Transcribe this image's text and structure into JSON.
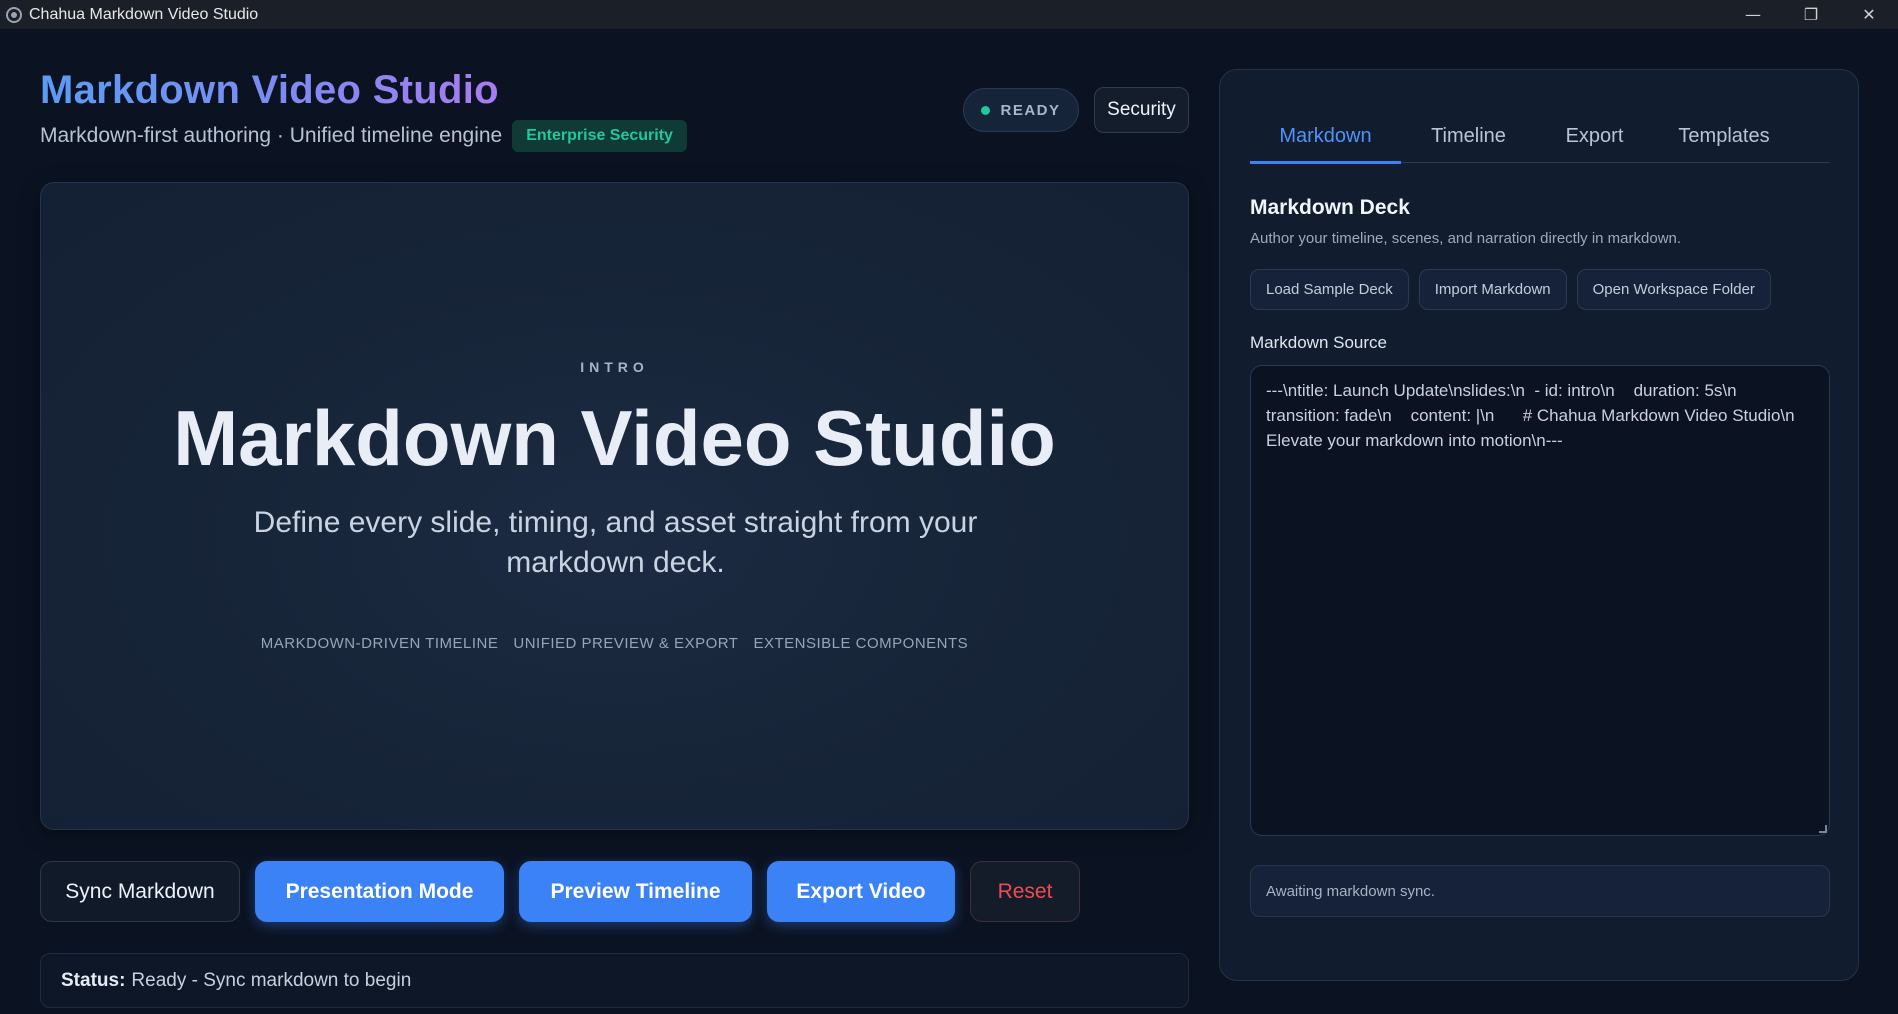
{
  "window": {
    "title": "Chahua Markdown Video Studio",
    "minimize_glyph": "—",
    "restore_glyph": "❐",
    "close_glyph": "✕"
  },
  "header": {
    "title": "Markdown Video Studio",
    "subtitle": "Markdown-first authoring · Unified timeline engine",
    "security_badge": "Enterprise Security",
    "ready_label": "READY",
    "security_button": "Security"
  },
  "stage": {
    "kicker": "INTRO",
    "title": "Markdown Video Studio",
    "description": "Define every slide, timing, and asset straight from your markdown deck.",
    "tags": [
      "MARKDOWN-DRIVEN TIMELINE",
      "UNIFIED PREVIEW & EXPORT",
      "EXTENSIBLE COMPONENTS"
    ]
  },
  "actions": {
    "sync": "Sync Markdown",
    "presentation": "Presentation Mode",
    "preview": "Preview Timeline",
    "export": "Export Video",
    "reset": "Reset"
  },
  "status": {
    "label": "Status:",
    "text": "Ready - Sync markdown to begin"
  },
  "panel": {
    "tabs": [
      "Markdown",
      "Timeline",
      "Export",
      "Templates"
    ],
    "active_tab": "Markdown",
    "deck_title": "Markdown Deck",
    "deck_description": "Author your timeline, scenes, and narration directly in markdown.",
    "deck_buttons": [
      "Load Sample Deck",
      "Import Markdown",
      "Open Workspace Folder"
    ],
    "source_label": "Markdown Source",
    "source_text": "---\\ntitle: Launch Update\\nslides:\\n  - id: intro\\n    duration: 5s\\n    transition: fade\\n    content: |\\n      # Chahua Markdown Video Studio\\n      Elevate your markdown into motion\\n---",
    "sync_message": "Awaiting markdown sync."
  },
  "colors": {
    "accent": "#3b82f6",
    "ready": "#22c79a",
    "reset": "#ef4b55",
    "background": "#0b1322"
  }
}
